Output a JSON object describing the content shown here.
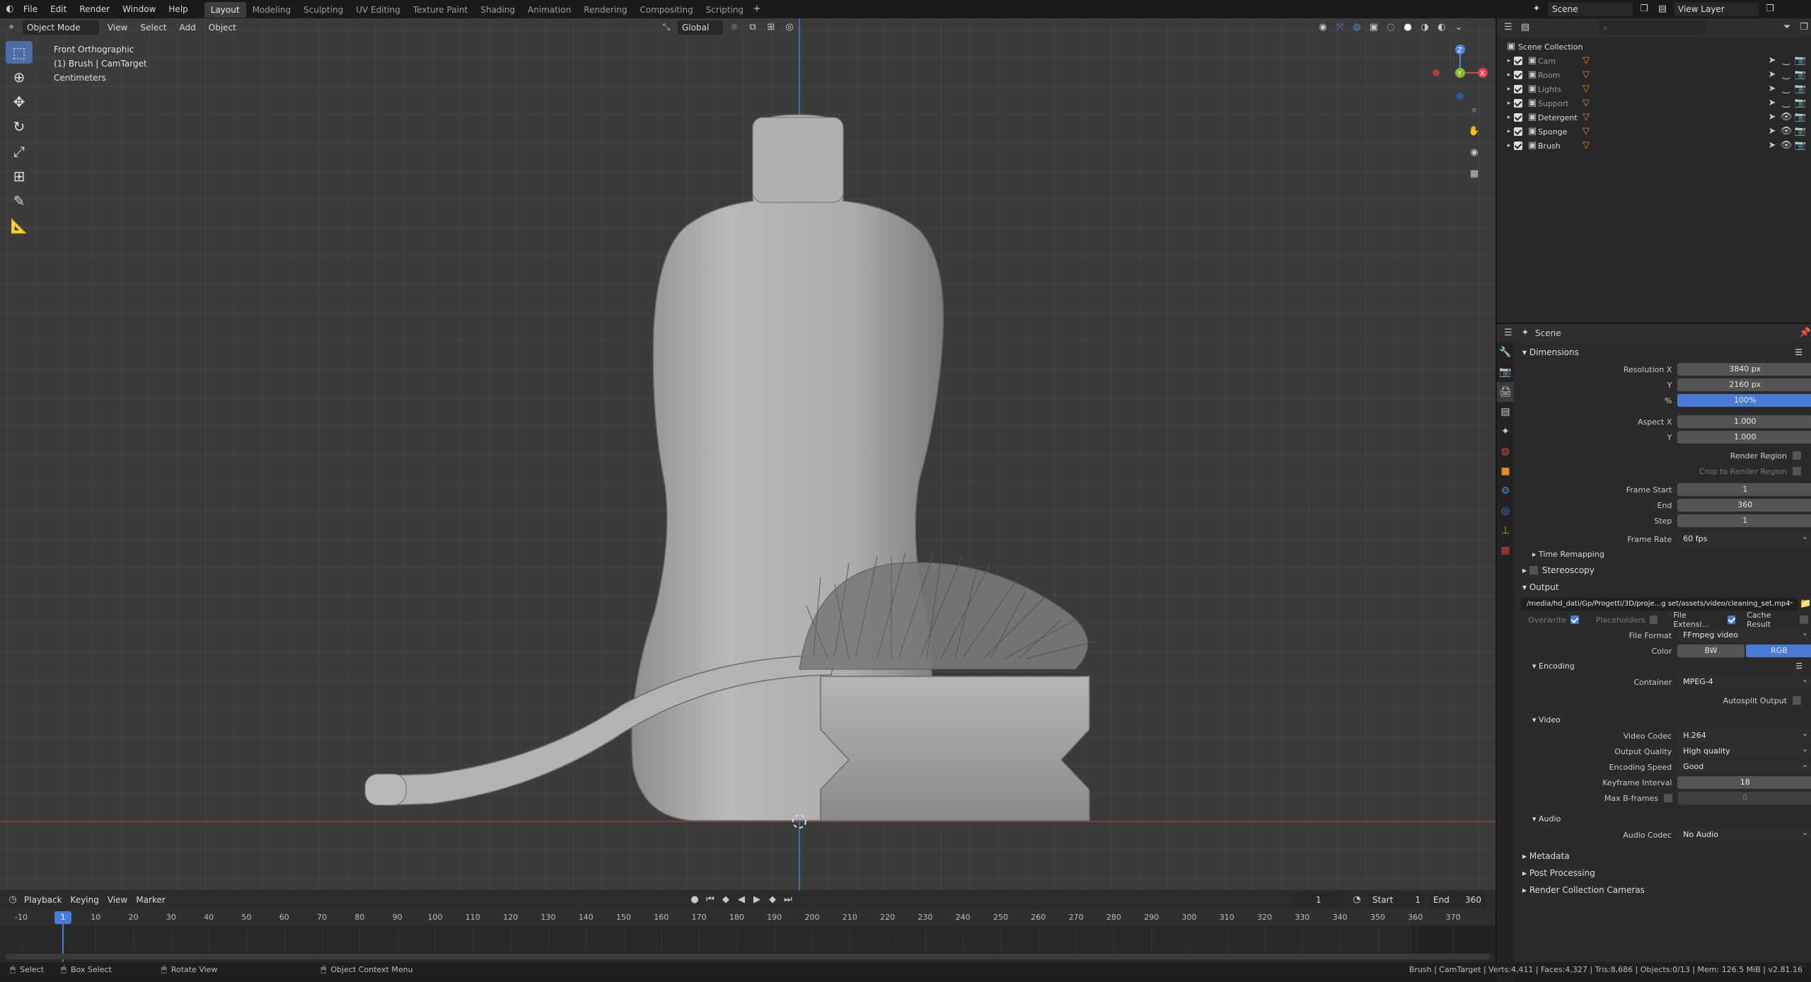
{
  "top_menu": [
    "File",
    "Edit",
    "Render",
    "Window",
    "Help"
  ],
  "workspaces": [
    {
      "label": "Layout",
      "active": true
    },
    {
      "label": "Modeling",
      "active": false
    },
    {
      "label": "Sculpting",
      "active": false
    },
    {
      "label": "UV Editing",
      "active": false
    },
    {
      "label": "Texture Paint",
      "active": false
    },
    {
      "label": "Shading",
      "active": false
    },
    {
      "label": "Animation",
      "active": false
    },
    {
      "label": "Rendering",
      "active": false
    },
    {
      "label": "Compositing",
      "active": false
    },
    {
      "label": "Scripting",
      "active": false
    }
  ],
  "scene_selector": "Scene",
  "view_layer": "View Layer",
  "viewport": {
    "mode": "Object Mode",
    "menus": [
      "View",
      "Select",
      "Add",
      "Object"
    ],
    "orientation": "Global",
    "overlay_lines": [
      "Front Orthographic",
      "(1) Brush | CamTarget",
      "Centimeters"
    ]
  },
  "outliner": {
    "root": "Scene Collection",
    "items": [
      {
        "name": "Cam",
        "bright": false
      },
      {
        "name": "Room",
        "bright": false
      },
      {
        "name": "Lights",
        "bright": false
      },
      {
        "name": "Support",
        "bright": false
      },
      {
        "name": "Detergent",
        "bright": true
      },
      {
        "name": "Sponge",
        "bright": true
      },
      {
        "name": "Brush",
        "bright": true
      }
    ]
  },
  "properties": {
    "context": "Scene",
    "dimensions": {
      "title": "Dimensions",
      "res_x_label": "Resolution X",
      "res_x": "3840 px",
      "res_y_label": "Y",
      "res_y": "2160 px",
      "pct_label": "%",
      "pct": "100%",
      "aspect_x_label": "Aspect X",
      "aspect_x": "1.000",
      "aspect_y_label": "Y",
      "aspect_y": "1.000",
      "render_region": "Render Region",
      "crop": "Crop to Render Region",
      "frame_start_label": "Frame Start",
      "frame_start": "1",
      "end_label": "End",
      "end": "360",
      "step_label": "Step",
      "step": "1",
      "frame_rate_label": "Frame Rate",
      "frame_rate": "60 fps",
      "time_remapping": "Time Remapping"
    },
    "stereoscopy": "Stereoscopy",
    "output": {
      "title": "Output",
      "path": "/media/hd_dati/Gp/Progetti/3D/proje...g set/assets/video/cleaning_set.mp4",
      "overwrite": "Overwrite",
      "placeholders": "Placeholders",
      "file_ext": "File Extensi...",
      "cache": "Cache Result",
      "file_format_label": "File Format",
      "file_format": "FFmpeg video",
      "color_label": "Color",
      "color_bw": "BW",
      "color_rgb": "RGB"
    },
    "encoding": {
      "title": "Encoding",
      "container_label": "Container",
      "container": "MPEG-4",
      "autosplit": "Autosplit Output"
    },
    "video": {
      "title": "Video",
      "codec_label": "Video Codec",
      "codec": "H.264",
      "quality_label": "Output Quality",
      "quality": "High quality",
      "speed_label": "Encoding Speed",
      "speed": "Good",
      "keyframe_label": "Keyframe Interval",
      "keyframe": "18",
      "bframes_label": "Max B-frames",
      "bframes": "0"
    },
    "audio": {
      "title": "Audio",
      "codec_label": "Audio Codec",
      "codec": "No Audio"
    },
    "collapsed": [
      "Metadata",
      "Post Processing",
      "Render Collection Cameras"
    ]
  },
  "timeline": {
    "menus": [
      "Playback",
      "Keying",
      "View",
      "Marker"
    ],
    "current_frame": "1",
    "start_label": "Start",
    "start": "1",
    "end_label": "End",
    "end": "360",
    "ticks": [
      "-10",
      "10",
      "20",
      "30",
      "40",
      "50",
      "60",
      "70",
      "80",
      "90",
      "100",
      "110",
      "120",
      "130",
      "140",
      "150",
      "160",
      "170",
      "180",
      "190",
      "200",
      "210",
      "220",
      "230",
      "240",
      "250",
      "260",
      "270",
      "280",
      "290",
      "300",
      "310",
      "320",
      "330",
      "340",
      "350",
      "360",
      "370"
    ]
  },
  "statusbar": {
    "select": "Select",
    "box_select": "Box Select",
    "rotate": "Rotate View",
    "context_menu": "Object Context Menu",
    "stats": "Brush | CamTarget | Verts:4,411 | Faces:4,327 | Tris:8,686 | Objects:0/13 | Mem: 126.5 MiB | v2.81.16"
  },
  "colors": {
    "accent": "#4a7bd6",
    "active_tool": "#4d6ea4",
    "axis_x": "#e0434e",
    "axis_y": "#86b829",
    "axis_z": "#4b88e0"
  }
}
